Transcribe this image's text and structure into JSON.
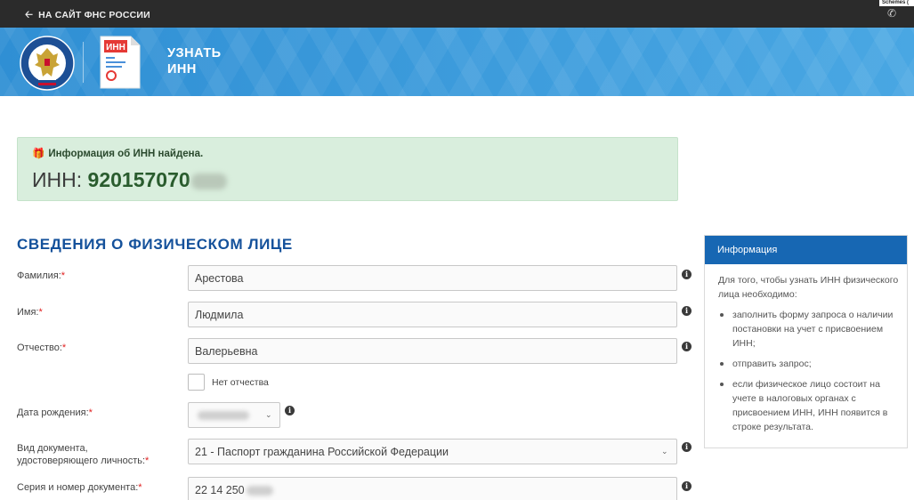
{
  "topbar": {
    "back_label": "НА САЙТ ФНС РОССИИ",
    "back_icon": "arrow-left-icon",
    "phone_icon": "phone-icon",
    "corner_text": "Schemes ("
  },
  "banner": {
    "inn_doc_label": "ИНН",
    "title_line1": "УЗНАТЬ",
    "title_line2": "ИНН"
  },
  "result": {
    "message": "Информация об ИНН найдена.",
    "inn_label": "ИНН:",
    "inn_value": "920157070"
  },
  "section": {
    "title": "СВЕДЕНИЯ О ФИЗИЧЕСКОМ ЛИЦЕ"
  },
  "form": {
    "surname_label": "Фамилия:",
    "surname_value": "Арестова",
    "name_label": "Имя:",
    "name_value": "Людмила",
    "patronymic_label": "Отчество:",
    "patronymic_value": "Валерьевна",
    "no_patronymic_label": "Нет отчества",
    "birthdate_label": "Дата рождения:",
    "doc_type_label_line1": "Вид документа,",
    "doc_type_label_line2": "удостоверяющего личность:",
    "doc_type_value": "21 - Паспорт гражданина Российской Федерации",
    "doc_number_label": "Серия и номер документа:",
    "doc_number_value": "22 14 250",
    "required_mark": "*"
  },
  "info_panel": {
    "title": "Информация",
    "intro": "Для того, чтобы узнать ИНН физического лица необходимо:",
    "items": [
      "заполнить форму запроса о наличии постановки на учет с присвоением ИНН;",
      "отправить запрос;",
      "если физическое лицо состоит на учете в налоговых органах с присвоением ИНН, ИНН появится в строке результата."
    ]
  },
  "colors": {
    "topbar": "#2b2b2b",
    "banner": "#3d9bd9",
    "success_bg": "#d9eedd",
    "heading": "#14519b",
    "panel_head": "#1767b3",
    "required": "#e02020"
  }
}
